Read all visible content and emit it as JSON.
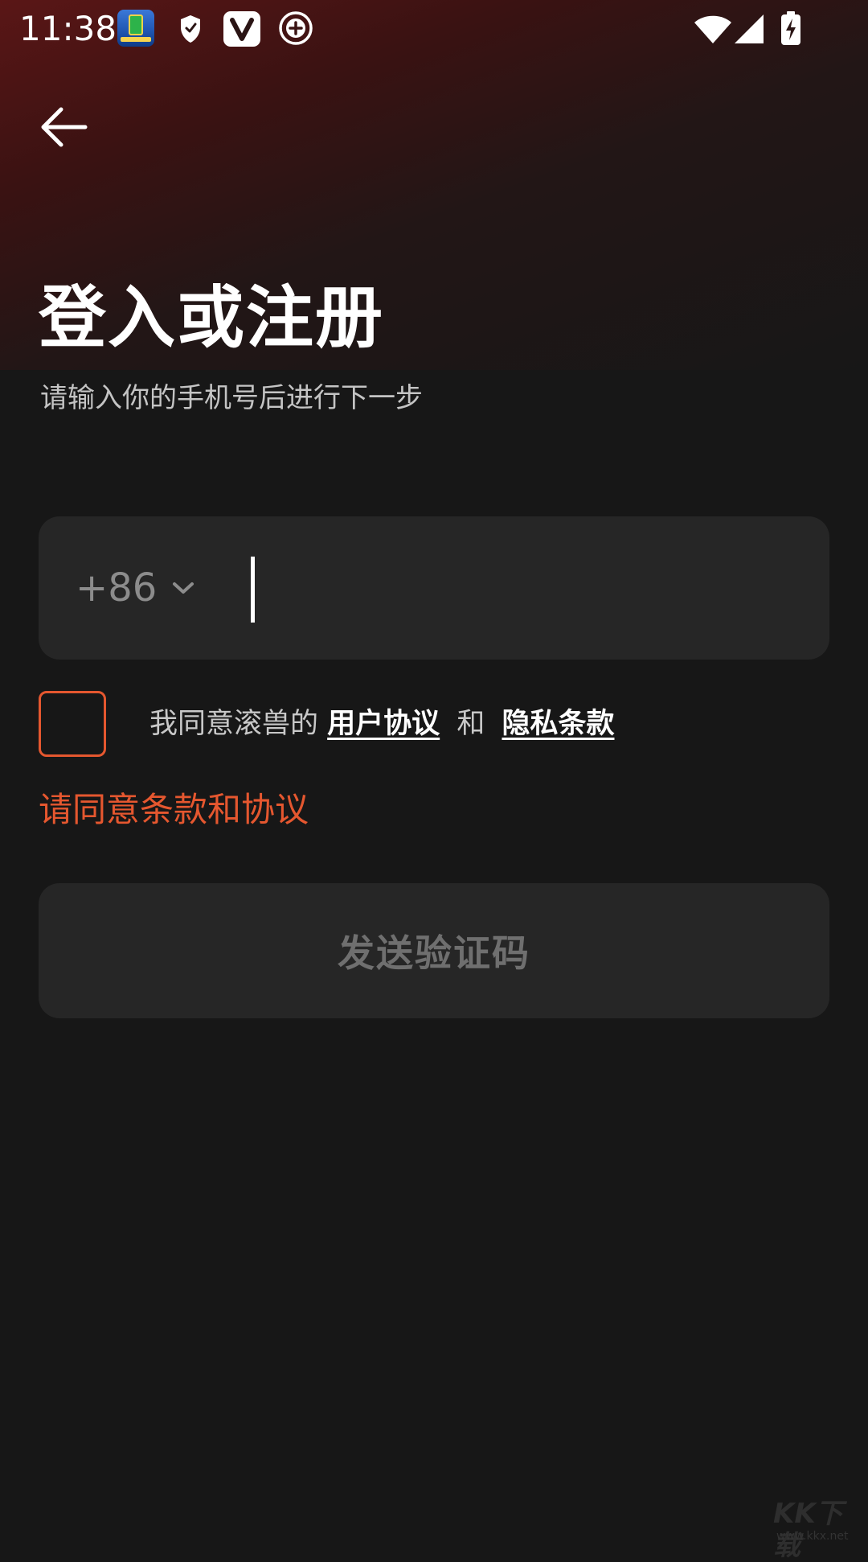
{
  "status_bar": {
    "time": "11:38",
    "notification_icons": [
      "app-icon",
      "shield-icon",
      "v-app-icon",
      "plus-circle-icon"
    ],
    "system_icons": [
      "wifi-icon",
      "signal-icon",
      "battery-charging-icon"
    ]
  },
  "header": {
    "back_icon": "arrow-left-icon"
  },
  "login": {
    "title": "登入或注册",
    "subtitle": "请输入你的手机号后进行下一步",
    "country_code": "+86",
    "phone_value": "",
    "agreement": {
      "prefix": "我同意滚兽的",
      "user_agreement": "用户协议",
      "and": "和",
      "privacy_policy": "隐私条款",
      "checked": false
    },
    "error": "请同意条款和协议",
    "send_code_label": "发送验证码"
  },
  "watermark": {
    "logo_text": "KK下载",
    "url": "www.kkx.net"
  },
  "colors": {
    "background": "#171717",
    "header_gradient": "#5a1616",
    "field_background": "#262626",
    "accent_error": "#e5572f",
    "disabled_text": "#6f6f6f"
  }
}
